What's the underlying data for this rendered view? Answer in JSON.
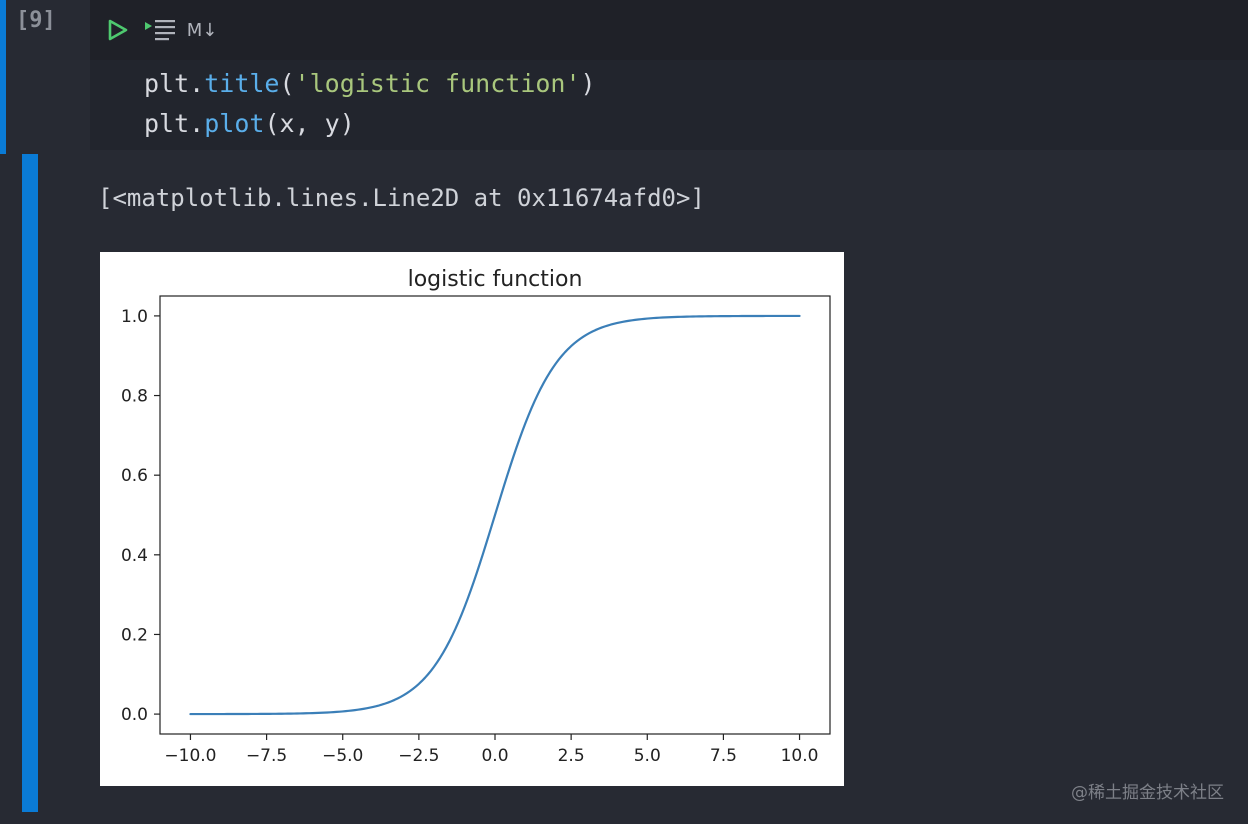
{
  "cell": {
    "exec_count": "[9]",
    "toolbar": {
      "markdown_label": "M↓"
    },
    "code_lines": [
      {
        "obj": "plt",
        "dot": ".",
        "fn": "title",
        "open": "(",
        "arg": "'logistic function'",
        "close": ")"
      },
      {
        "obj": "plt",
        "dot": ".",
        "fn": "plot",
        "open": "(",
        "arg": "x, y",
        "close": ")"
      }
    ],
    "output_text": "[<matplotlib.lines.Line2D at 0x11674afd0>]"
  },
  "watermark": "@稀土掘金技术社区",
  "colors": {
    "accent": "#0a7bd6",
    "run": "#4ec96f",
    "line": "#3b7fb8"
  },
  "chart_data": {
    "type": "line",
    "title": "logistic function",
    "xlabel": "",
    "ylabel": "",
    "xlim": [
      -11,
      11
    ],
    "ylim": [
      -0.05,
      1.05
    ],
    "xticks": [
      -10.0,
      -7.5,
      -5.0,
      -2.5,
      0.0,
      2.5,
      5.0,
      7.5,
      10.0
    ],
    "xtick_labels": [
      "−10.0",
      "−7.5",
      "−5.0",
      "−2.5",
      "0.0",
      "2.5",
      "5.0",
      "7.5",
      "10.0"
    ],
    "yticks": [
      0.0,
      0.2,
      0.4,
      0.6,
      0.8,
      1.0
    ],
    "ytick_labels": [
      "0.0",
      "0.2",
      "0.4",
      "0.6",
      "0.8",
      "1.0"
    ],
    "grid": false,
    "series": [
      {
        "x": [
          -10,
          -9,
          -8,
          -7,
          -6,
          -5,
          -4.5,
          -4,
          -3.5,
          -3,
          -2.5,
          -2,
          -1.5,
          -1,
          -0.5,
          0,
          0.5,
          1,
          1.5,
          2,
          2.5,
          3,
          3.5,
          4,
          4.5,
          5,
          6,
          7,
          8,
          9,
          10
        ],
        "y": [
          5e-05,
          0.0001,
          0.0003,
          0.0009,
          0.0025,
          0.0067,
          0.011,
          0.018,
          0.029,
          0.047,
          0.076,
          0.119,
          0.182,
          0.269,
          0.378,
          0.5,
          0.622,
          0.731,
          0.818,
          0.881,
          0.924,
          0.953,
          0.971,
          0.982,
          0.989,
          0.993,
          0.9975,
          0.9991,
          0.9997,
          0.9999,
          0.99995
        ]
      }
    ]
  }
}
